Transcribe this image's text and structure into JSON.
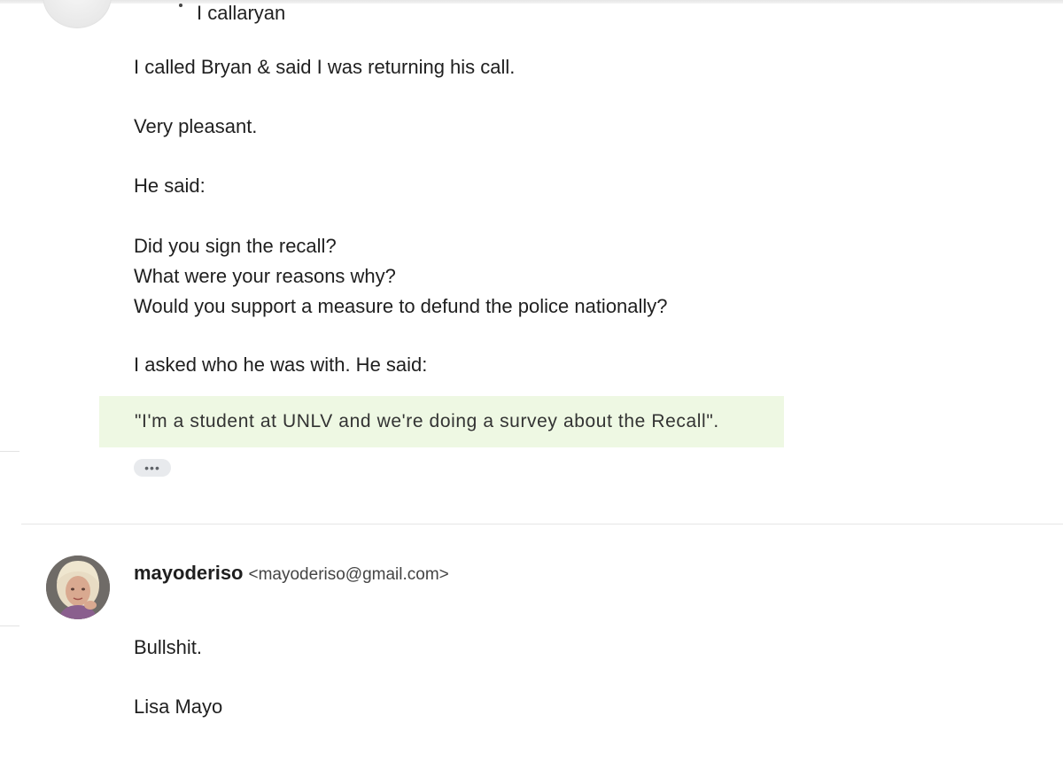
{
  "previous_message": {
    "cut_header_text": "I callaryan",
    "paragraphs": [
      "I called Bryan & said I was returning his call.",
      "Very pleasant.",
      "He said:",
      "Did you sign the recall?",
      "What were your reasons why?",
      "Would you support a measure to defund the police nationally?",
      "I asked who he was with.  He said:"
    ],
    "quote": "\"I'm a student at UNLV and we're doing a survey about the Recall\".",
    "quote_background": "#eef8e3",
    "show_trimmed_label": "•••"
  },
  "reply": {
    "sender_name": "mayoderiso",
    "sender_email": "<mayoderiso@gmail.com>",
    "body": "Bullshit.",
    "signature": "Lisa Mayo"
  }
}
